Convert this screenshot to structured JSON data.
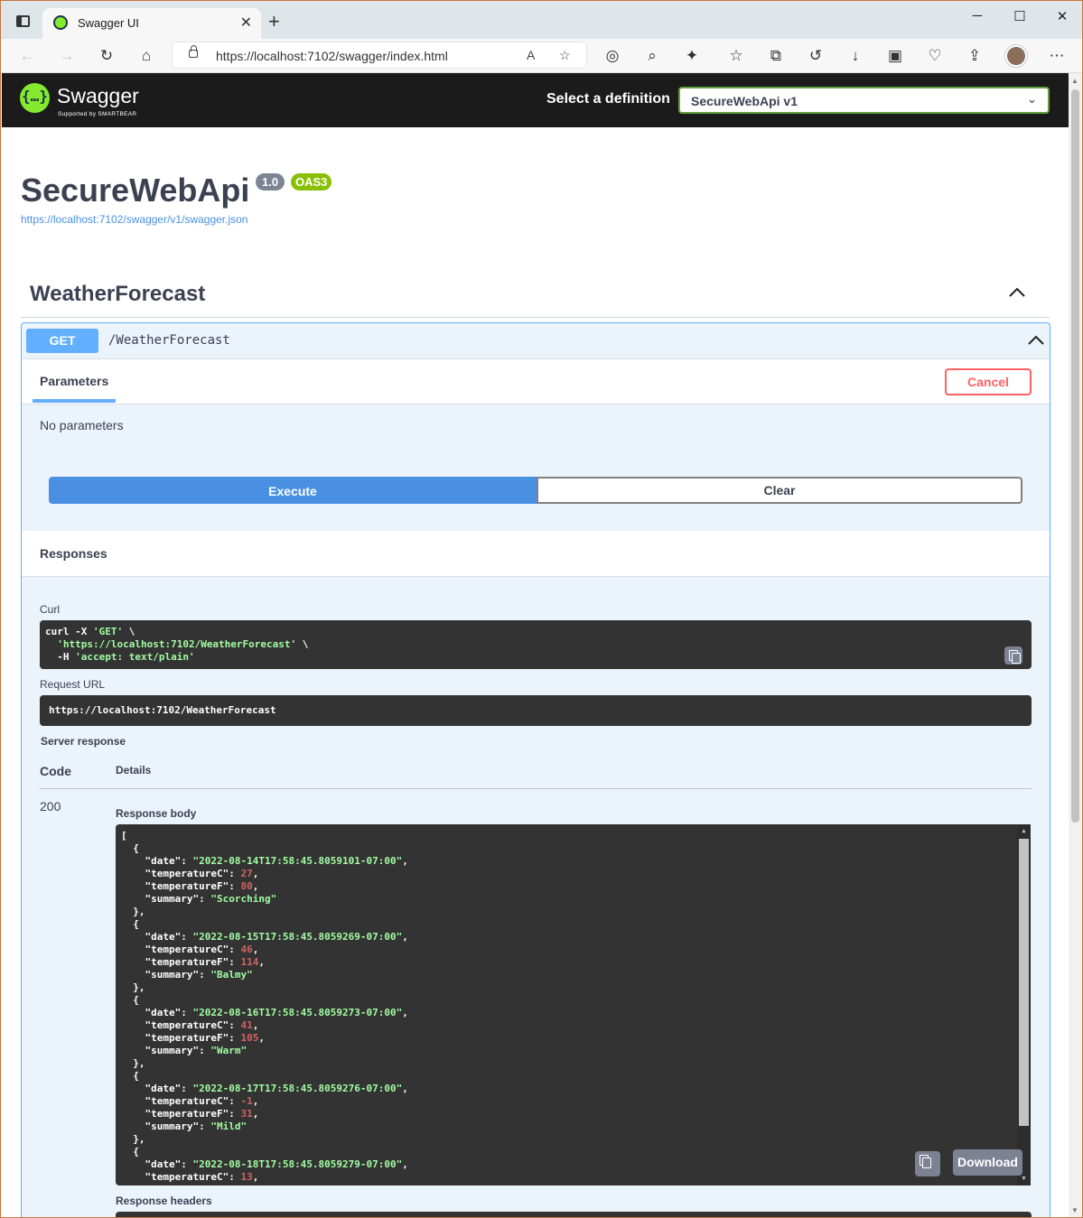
{
  "browser": {
    "tab_title": "Swagger UI",
    "tab_close": "✕",
    "new_tab": "+",
    "url": "https://localhost:7102/swagger/index.html",
    "window_controls": {
      "minimize": "─",
      "maximize": "☐",
      "close": "✕"
    }
  },
  "topbar": {
    "logo_symbol": "{…}",
    "logo_text": "Swagger",
    "logo_sub": "Supported by SMARTBEAR",
    "definition_label": "Select a definition",
    "definition_value": "SecureWebApi v1"
  },
  "info": {
    "title": "SecureWebApi",
    "version": "1.0",
    "oas": "OAS3",
    "spec_url": "https://localhost:7102/swagger/v1/swagger.json"
  },
  "tag": {
    "name": "WeatherForecast"
  },
  "operation": {
    "method": "GET",
    "path": "/WeatherForecast",
    "parameters_tab": "Parameters",
    "cancel_label": "Cancel",
    "no_params": "No parameters",
    "execute_label": "Execute",
    "clear_label": "Clear",
    "responses_label": "Responses",
    "curl_label": "Curl",
    "curl_lines": [
      [
        "curl -X ",
        "'GET'",
        " \\"
      ],
      [
        "  ",
        "'https://localhost:7102/WeatherForecast'",
        " \\"
      ],
      [
        "  -H ",
        "'accept: text/plain'",
        ""
      ]
    ],
    "request_url_label": "Request URL",
    "request_url": "https://localhost:7102/WeatherForecast",
    "server_response_label": "Server response",
    "code_header": "Code",
    "details_header": "Details",
    "response_code": "200",
    "response_body_label": "Response body",
    "response_headers_label": "Response headers",
    "download_label": "Download",
    "response_items": [
      {
        "date": "2022-08-14T17:58:45.8059101-07:00",
        "temperatureC": 27,
        "temperatureF": 80,
        "summary": "Scorching"
      },
      {
        "date": "2022-08-15T17:58:45.8059269-07:00",
        "temperatureC": 46,
        "temperatureF": 114,
        "summary": "Balmy"
      },
      {
        "date": "2022-08-16T17:58:45.8059273-07:00",
        "temperatureC": 41,
        "temperatureF": 105,
        "summary": "Warm"
      },
      {
        "date": "2022-08-17T17:58:45.8059276-07:00",
        "temperatureC": -1,
        "temperatureF": 31,
        "summary": "Mild"
      },
      {
        "date": "2022-08-18T17:58:45.8059279-07:00",
        "temperatureC": 13
      }
    ]
  },
  "colors": {
    "get_blue": "#61affe",
    "execute_blue": "#4990e2",
    "cancel_red": "#ff6060",
    "swagger_green": "#85ea2d",
    "oas_green": "#89bf04"
  }
}
